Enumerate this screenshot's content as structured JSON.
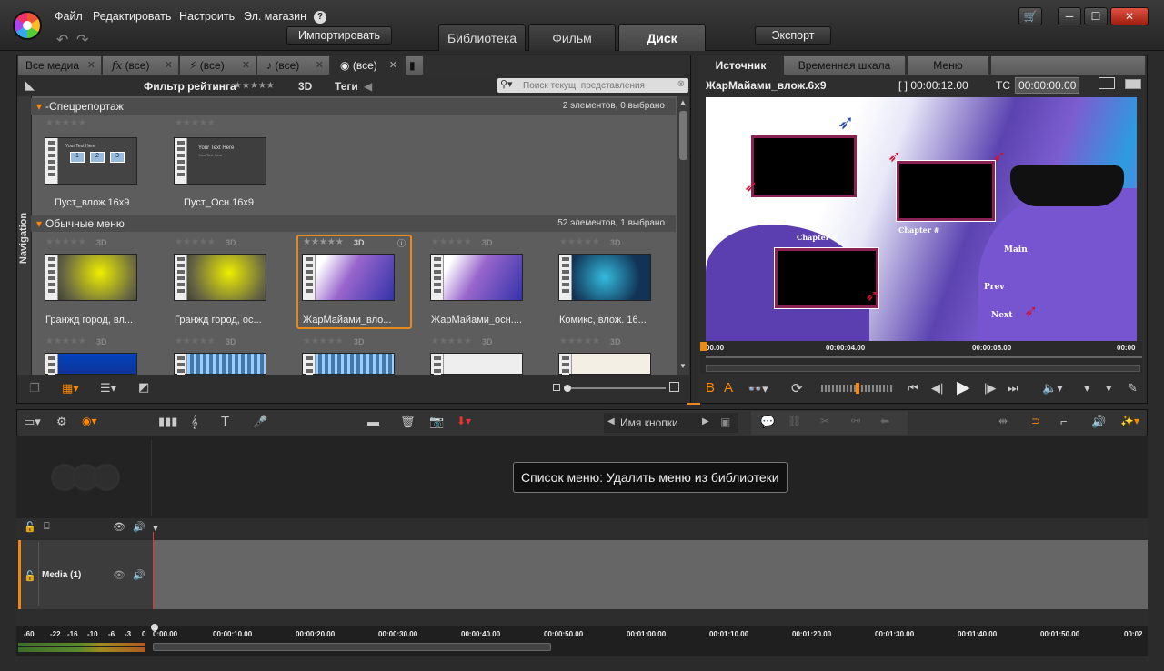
{
  "menubar": {
    "items": [
      "Файл",
      "Редактировать",
      "Настроить",
      "Эл. магазин"
    ],
    "help_label": "?"
  },
  "toolbar": {
    "import_label": "Импортировать",
    "export_label": "Экспорт"
  },
  "main_tabs": [
    "Библиотека",
    "Фильм",
    "Диск"
  ],
  "window_controls": {
    "store": "🛒",
    "minimize": "─",
    "maximize": "☐",
    "close": "✕"
  },
  "library": {
    "tabs": [
      "Все медиа",
      "(все)",
      "(все)",
      "(все)",
      "(все)"
    ],
    "tab_close": "✕",
    "filter_label": "Фильтр рейтинга",
    "filter_3d": "3D",
    "tags_label": "Теги",
    "search_placeholder": "Поиск текущ. представления",
    "navigation_label": "Navigation",
    "groups": [
      {
        "name": "-Спецрепортаж",
        "count": "2 элементов, 0 выбрано",
        "items": [
          {
            "label": "Пуст_влож.16x9"
          },
          {
            "label": "Пуст_Осн.16x9"
          }
        ]
      },
      {
        "name": "Обычные меню",
        "count": "52 элементов, 1 выбрано",
        "items": [
          {
            "label": "Гранжд город, вл..."
          },
          {
            "label": "Гранжд город, ос..."
          },
          {
            "label": "ЖарМайами_вло..."
          },
          {
            "label": "ЖарМайами_осн...."
          },
          {
            "label": "Комикс, влож. 16..."
          }
        ]
      }
    ],
    "stars": "★★★★★",
    "threed": "3D",
    "thumb_text": "Your Text Here",
    "thumb_sub": "Your Text Here",
    "chapters": [
      "1",
      "2",
      "3"
    ]
  },
  "preview": {
    "tabs": [
      "Источник",
      "Временная шкала",
      "Меню"
    ],
    "filename": "ЖарМайами_влож.6x9",
    "duration": "[ ] 00:00:12.00",
    "tc_label": "TC",
    "timecode": "00:00:00.00",
    "chapter_label": "Chapter #",
    "nav_labels": [
      "Main",
      "Prev",
      "Next"
    ],
    "scrub_ticks": [
      "00.00",
      "00:00:04.00",
      "00:00:08.00",
      "00:00"
    ]
  },
  "timeline": {
    "button_name_label": "Имя кнопки",
    "tooltip": "Список меню: Удалить меню из библиотеки",
    "track_name": "Media (1)",
    "ruler": [
      "0:00.00",
      "00:00:10.00",
      "00:00:20.00",
      "00:00:30.00",
      "00:00:40.00",
      "00:00:50.00",
      "00:01:00.00",
      "00:01:10.00",
      "00:01:20.00",
      "00:01:30.00",
      "00:01:40.00",
      "00:01:50.00",
      "00:02"
    ],
    "meter_scale": [
      "-60",
      "-22",
      "-16",
      "-10",
      "-6",
      "-3",
      "0"
    ]
  }
}
